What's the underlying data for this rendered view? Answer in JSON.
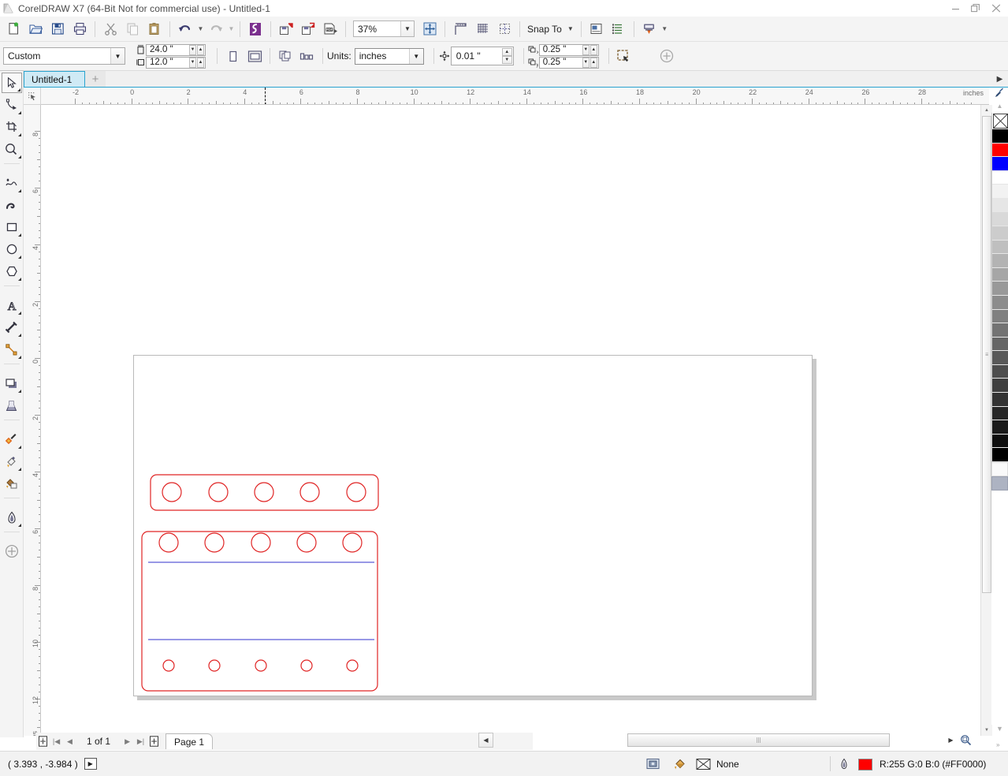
{
  "window": {
    "title": "CorelDRAW X7 (64-Bit Not for commercial use) - Untitled-1",
    "app_icon": "coreldraw-icon",
    "minimize_label": "—",
    "restore_label": "❐",
    "close_label": "✕"
  },
  "toolbar": {
    "buttons": [
      {
        "name": "new-document-button",
        "icon": "new-document-icon",
        "tooltip": "New"
      },
      {
        "name": "open-document-button",
        "icon": "open-folder-icon",
        "tooltip": "Open"
      },
      {
        "name": "save-document-button",
        "icon": "save-disk-icon",
        "tooltip": "Save"
      },
      {
        "name": "print-button",
        "icon": "printer-icon",
        "tooltip": "Print"
      },
      {
        "name": "cut-button",
        "icon": "scissors-icon",
        "tooltip": "Cut"
      },
      {
        "name": "copy-button",
        "icon": "copy-icon",
        "tooltip": "Copy"
      },
      {
        "name": "paste-button",
        "icon": "clipboard-paste-icon",
        "tooltip": "Paste"
      },
      {
        "name": "undo-button",
        "icon": "undo-arrow-icon",
        "tooltip": "Undo"
      },
      {
        "name": "redo-button",
        "icon": "redo-arrow-icon",
        "tooltip": "Redo"
      },
      {
        "name": "corel-connect-button",
        "icon": "corel-connect-icon",
        "tooltip": "Search Content"
      },
      {
        "name": "import-button",
        "icon": "import-icon",
        "tooltip": "Import"
      },
      {
        "name": "export-button",
        "icon": "export-icon",
        "tooltip": "Export"
      },
      {
        "name": "publish-pdf-button",
        "icon": "pdf-export-icon",
        "tooltip": "Publish to PDF"
      }
    ],
    "zoom_level": "37%",
    "zoom_caret": "▼",
    "fullscreen_button": {
      "name": "zoom-levels-button",
      "icon": "zoom-fit-icon"
    },
    "show_rulers_button": {
      "name": "show-rulers-button",
      "icon": "ruler-icon"
    },
    "show_grid_button": {
      "name": "show-grid-button",
      "icon": "grid-icon"
    },
    "show_guides_button": {
      "name": "show-guides-button",
      "icon": "guides-icon"
    },
    "snap_to_label": "Snap To",
    "snap_to_caret": "▼",
    "options_button": {
      "name": "options-button",
      "icon": "options-dialog-icon"
    },
    "object_manager_button": {
      "name": "object-manager-button",
      "icon": "object-list-icon"
    },
    "application_launcher_button": {
      "name": "application-launcher-button",
      "icon": "launcher-icon"
    },
    "application_launcher_caret": "▼"
  },
  "propertybar": {
    "page_preset": "Custom",
    "preset_caret": "▼",
    "page_width": "24.0 \"",
    "page_height": "12.0 \"",
    "width_icon": "page-width-icon",
    "height_icon": "page-height-icon",
    "spin_up": "▲",
    "spin_down": "▼",
    "portrait_button": {
      "name": "portrait-orientation-button",
      "icon": "portrait-page-icon"
    },
    "landscape_button": {
      "name": "landscape-orientation-button",
      "icon": "landscape-page-icon"
    },
    "all_pages_button": {
      "name": "apply-to-all-pages-button",
      "icon": "all-pages-icon"
    },
    "current_page_button": {
      "name": "apply-to-current-page-button",
      "icon": "current-page-icon"
    },
    "units_label": "Units:",
    "units_value": "inches",
    "units_caret": "▼",
    "nudge_icon": "nudge-arrows-icon",
    "nudge_value": "0.01 \"",
    "duplicate_x_icon": "duplicate-offset-x-icon",
    "duplicate_x_value": "0.25 \"",
    "duplicate_y_icon": "duplicate-offset-y-icon",
    "duplicate_y_value": "0.25 \"",
    "treat_as_filled_button": {
      "name": "treat-all-objects-as-filled-button",
      "icon": "filled-object-icon"
    },
    "add_button": {
      "name": "add-property-button",
      "icon": "plus-circle-icon"
    }
  },
  "tabbar": {
    "tool_indicator": "pick-tool-icon",
    "document_tab": "Untitled-1",
    "new_tab_label": "+"
  },
  "toolbox": {
    "tools": [
      {
        "name": "pick-tool",
        "icon": "arrow-cursor-icon",
        "label": "Pick",
        "active": true,
        "flyout": true
      },
      {
        "name": "shape-tool",
        "icon": "node-edit-icon",
        "label": "Shape",
        "active": false,
        "flyout": true
      },
      {
        "name": "crop-tool",
        "icon": "crop-icon",
        "label": "Crop",
        "active": false,
        "flyout": true
      },
      {
        "name": "zoom-tool",
        "icon": "magnifier-icon",
        "label": "Zoom",
        "active": false,
        "flyout": true
      },
      {
        "name": "freehand-tool",
        "icon": "freehand-curve-icon",
        "label": "Freehand",
        "active": false,
        "flyout": true
      },
      {
        "name": "artistic-media-tool",
        "icon": "artistic-media-icon",
        "label": "Artistic Media",
        "active": false,
        "flyout": false
      },
      {
        "name": "rectangle-tool",
        "icon": "rectangle-icon",
        "label": "Rectangle",
        "active": false,
        "flyout": true
      },
      {
        "name": "ellipse-tool",
        "icon": "ellipse-icon",
        "label": "Ellipse",
        "active": false,
        "flyout": true
      },
      {
        "name": "polygon-tool",
        "icon": "polygon-icon",
        "label": "Polygon",
        "active": false,
        "flyout": true
      },
      {
        "name": "text-tool",
        "icon": "text-a-icon",
        "label": "Text",
        "active": false,
        "flyout": true
      },
      {
        "name": "parallel-dimension-tool",
        "icon": "dimension-icon",
        "label": "Parallel Dimension",
        "active": false,
        "flyout": true
      },
      {
        "name": "straight-line-connector-tool",
        "icon": "connector-line-icon",
        "label": "Straight-Line Connector",
        "active": false,
        "flyout": true
      },
      {
        "name": "drop-shadow-tool",
        "icon": "drop-shadow-icon",
        "label": "Drop Shadow",
        "active": false,
        "flyout": true
      },
      {
        "name": "transparency-tool",
        "icon": "transparency-icon",
        "label": "Transparency",
        "active": false,
        "flyout": false
      },
      {
        "name": "color-eyedropper-tool",
        "icon": "eyedropper-icon",
        "label": "Color Eyedropper",
        "active": false,
        "flyout": true
      },
      {
        "name": "interactive-fill-tool",
        "icon": "interactive-fill-icon",
        "label": "Interactive Fill",
        "active": false,
        "flyout": true
      },
      {
        "name": "smart-fill-tool",
        "icon": "smart-fill-icon",
        "label": "Smart Fill",
        "active": false,
        "flyout": false
      },
      {
        "name": "outline-tool",
        "icon": "outline-pen-icon",
        "label": "Outline",
        "active": false,
        "flyout": true
      },
      {
        "name": "fill-tool",
        "icon": "fill-plus-icon",
        "label": "Fill",
        "active": false,
        "flyout": false
      }
    ]
  },
  "rulers": {
    "horizontal_unit": "inches",
    "horizontal_labels": [
      "-2",
      "0",
      "2",
      "4",
      "6",
      "8",
      "10",
      "12",
      "14",
      "16",
      "18",
      "20",
      "22",
      "24",
      "26",
      "28"
    ],
    "vertical_unit": "inches",
    "vertical_labels": [
      "8",
      "6",
      "4",
      "2",
      "0",
      "2",
      "4",
      "6",
      "8",
      "10",
      "12"
    ]
  },
  "canvas": {
    "page_label": "drawing-page",
    "outline_color": "#E02424",
    "guide_color": "#5B5BD6",
    "shapes": [
      {
        "name": "top-rail-rectangle",
        "holes": 5
      },
      {
        "name": "middle-rail-rectangle",
        "holes": 5
      },
      {
        "name": "bottom-rail-rectangle",
        "holes": 5
      }
    ]
  },
  "pagenav": {
    "add_page_start_button": {
      "name": "add-page-before-button",
      "icon": "add-page-icon"
    },
    "first_button": "|◀",
    "prev_button": "◀",
    "page_indicator": "1 of 1",
    "next_button": "▶",
    "last_button": "▶|",
    "add_page_end_button": {
      "name": "add-page-after-button",
      "icon": "add-page-icon"
    },
    "page_tab": "Page 1"
  },
  "statusbar": {
    "cursor_coords": "( 3.393 , -3.984 )",
    "coords_button_label": "▶",
    "screen_icon": "screen-preview-icon",
    "fill_icon": "fill-bucket-icon",
    "fill_value": "None",
    "no_fill_icon": "no-fill-x-icon",
    "outline_icon": "outline-pen-icon",
    "outline_color": "#FF0000",
    "outline_value": "R:255 G:0 B:0 (#FF0000)"
  },
  "palette": {
    "scroll_up_label": "▲",
    "scroll_down_label": "▼",
    "expand_label": "▶",
    "no_color_label": "✕",
    "colors": [
      "#000000",
      "#FF0000",
      "#0000FF",
      "#FFFFFF",
      "#F2F2F2",
      "#E6E6E6",
      "#D9D9D9",
      "#CCCCCC",
      "#BFBFBF",
      "#B3B3B3",
      "#A6A6A6",
      "#999999",
      "#8C8C8C",
      "#808080",
      "#737373",
      "#666666",
      "#595959",
      "#4D4D4D",
      "#404040",
      "#333333",
      "#262626",
      "#1A1A1A",
      "#0D0D0D",
      "#000000"
    ],
    "footer_colors": [
      "#FAFAFA",
      "#ADB3C2"
    ]
  },
  "scrollbars": {
    "vertical_up": "▲",
    "vertical_down": "▼",
    "horizontal_left": "◀",
    "horizontal_right": "▶",
    "grip": "|||",
    "zoom_tool_button": {
      "name": "zoom-one-shot-button",
      "icon": "magnifier-icon"
    }
  }
}
